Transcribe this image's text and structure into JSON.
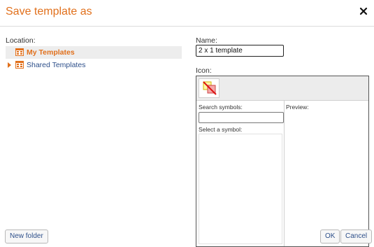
{
  "dialog": {
    "title": "Save template as",
    "accent_color": "#e1701c",
    "close_icon": "close-icon"
  },
  "location": {
    "label": "Location:",
    "items": [
      {
        "label": "My Templates",
        "selected": true,
        "icon": "folder-icon"
      },
      {
        "label": "Shared Templates",
        "selected": false,
        "expandable": true,
        "icon": "folder-icon"
      }
    ]
  },
  "name": {
    "label": "Name:",
    "value": "2 x 1 template"
  },
  "icon": {
    "label": "Icon:",
    "symbol": "no-symbol-icon",
    "search_label": "Search symbols:",
    "search_value": "",
    "select_label": "Select a symbol:",
    "preview_label": "Preview:"
  },
  "footer": {
    "new_folder": "New folder",
    "ok": "OK",
    "cancel": "Cancel"
  }
}
